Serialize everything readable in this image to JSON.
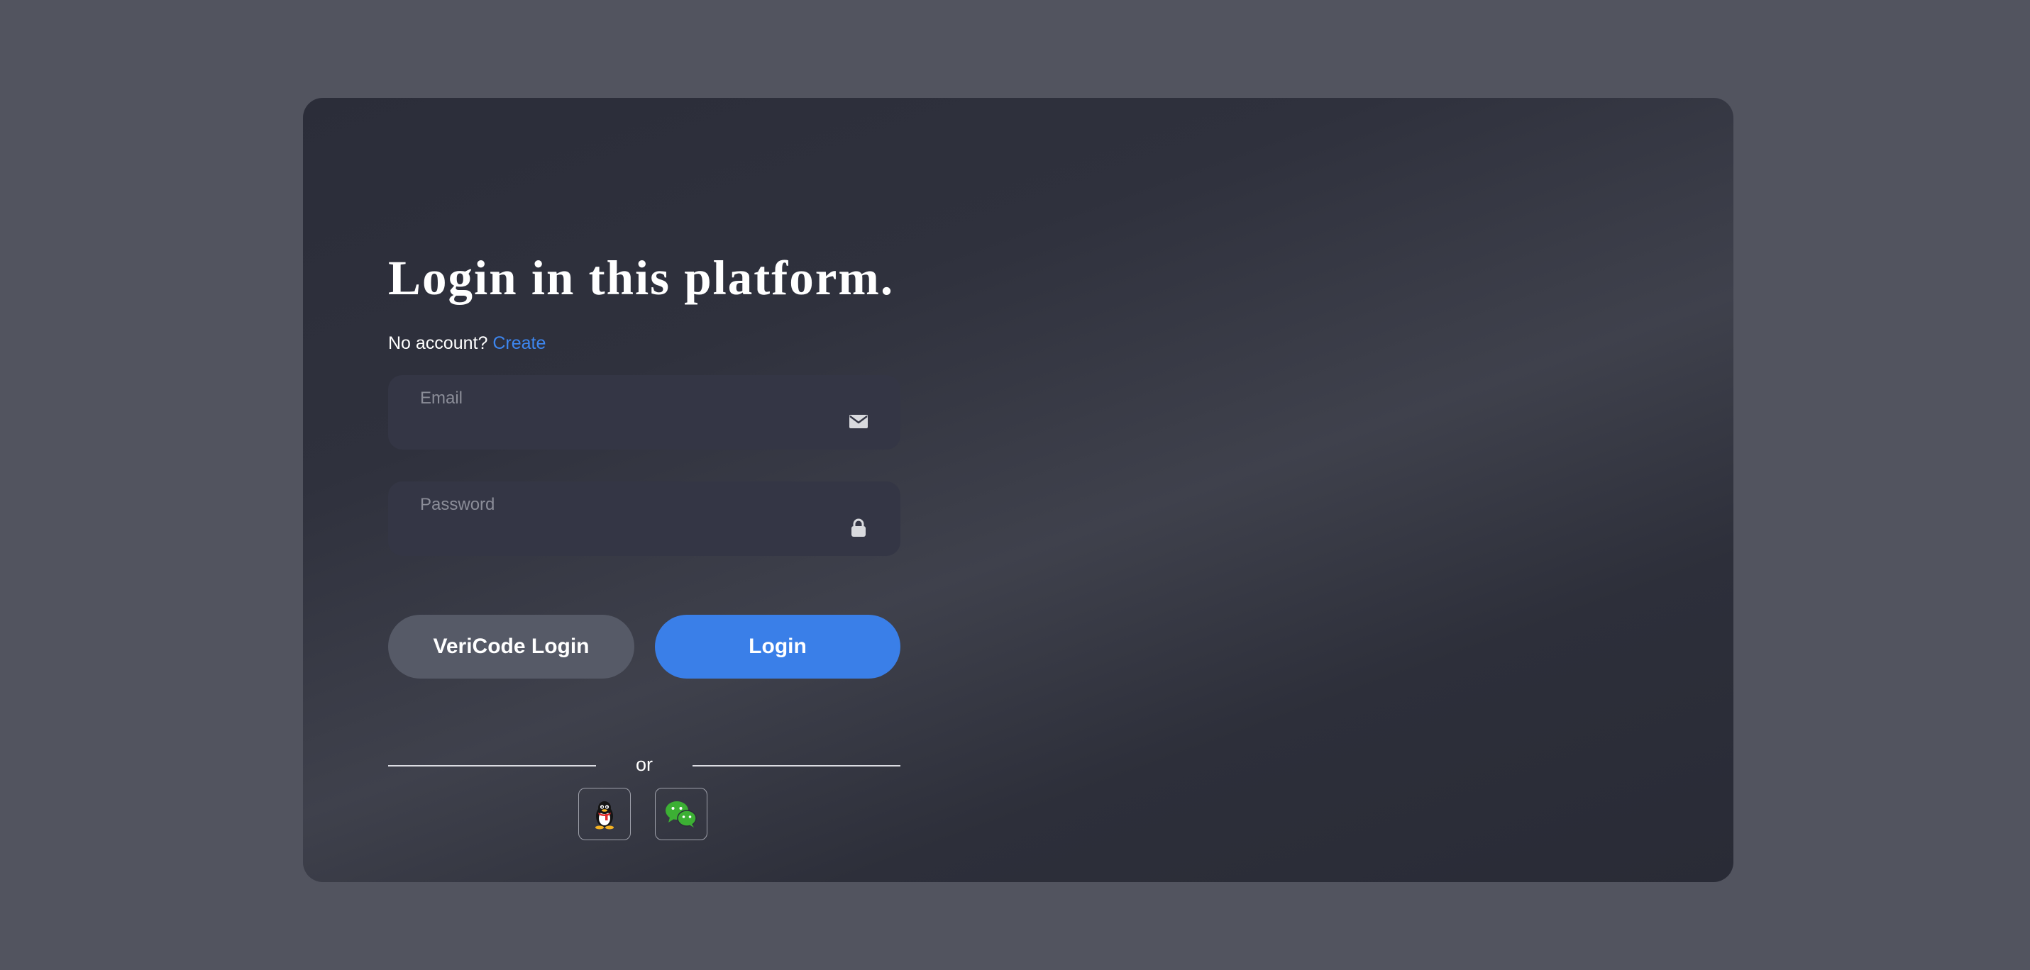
{
  "login": {
    "title": "Login in this platform.",
    "no_account_text": "No account?",
    "create_link": "Create",
    "email_placeholder": "Email",
    "password_placeholder": "Password",
    "vericode_button": "VeriCode Login",
    "login_button": "Login",
    "divider_text": "or",
    "social": [
      {
        "name": "QQ",
        "icon": "qq-penguin-icon"
      },
      {
        "name": "WeChat",
        "icon": "wechat-icon"
      }
    ]
  },
  "colors": {
    "page_background": "#52545f",
    "card_background": "#2f313d",
    "accent": "#3a7fe8",
    "link": "#3d86ef",
    "secondary_button": "#565a67",
    "input_background": "#343645",
    "wechat_green": "#3cb034"
  }
}
